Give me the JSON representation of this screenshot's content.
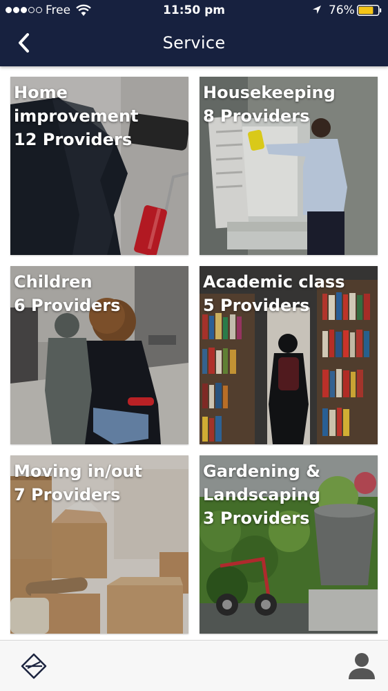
{
  "status_bar": {
    "carrier": "Free",
    "time": "11:50 pm",
    "battery_percent": "76%",
    "battery_level": 0.76,
    "signal_bars_filled": 3,
    "signal_bars_total": 5,
    "icons": [
      "signal-dots-icon",
      "wifi-icon",
      "location-arrow-icon",
      "battery-icon"
    ]
  },
  "nav": {
    "title": "Service",
    "back_icon": "chevron-left-icon"
  },
  "services": [
    {
      "title": "Home improvement",
      "providers": "12 Providers"
    },
    {
      "title": "Housekeeping",
      "providers": "8 Providers"
    },
    {
      "title": "Children",
      "providers": "6 Providers"
    },
    {
      "title": "Academic class",
      "providers": "5 Providers"
    },
    {
      "title": "Moving in/out",
      "providers": "7 Providers"
    },
    {
      "title": "Gardening & Landscaping",
      "providers": "3 Providers"
    }
  ],
  "tab_bar": {
    "items": [
      {
        "icon": "logo-diamond-icon"
      },
      {
        "icon": "user-profile-icon"
      }
    ]
  },
  "colors": {
    "header_bg": "#17213f",
    "tab_bar_bg": "#f7f7f7",
    "battery_fill": "#f5c518",
    "icon_dark": "#1d2540",
    "icon_gray": "#555555"
  }
}
